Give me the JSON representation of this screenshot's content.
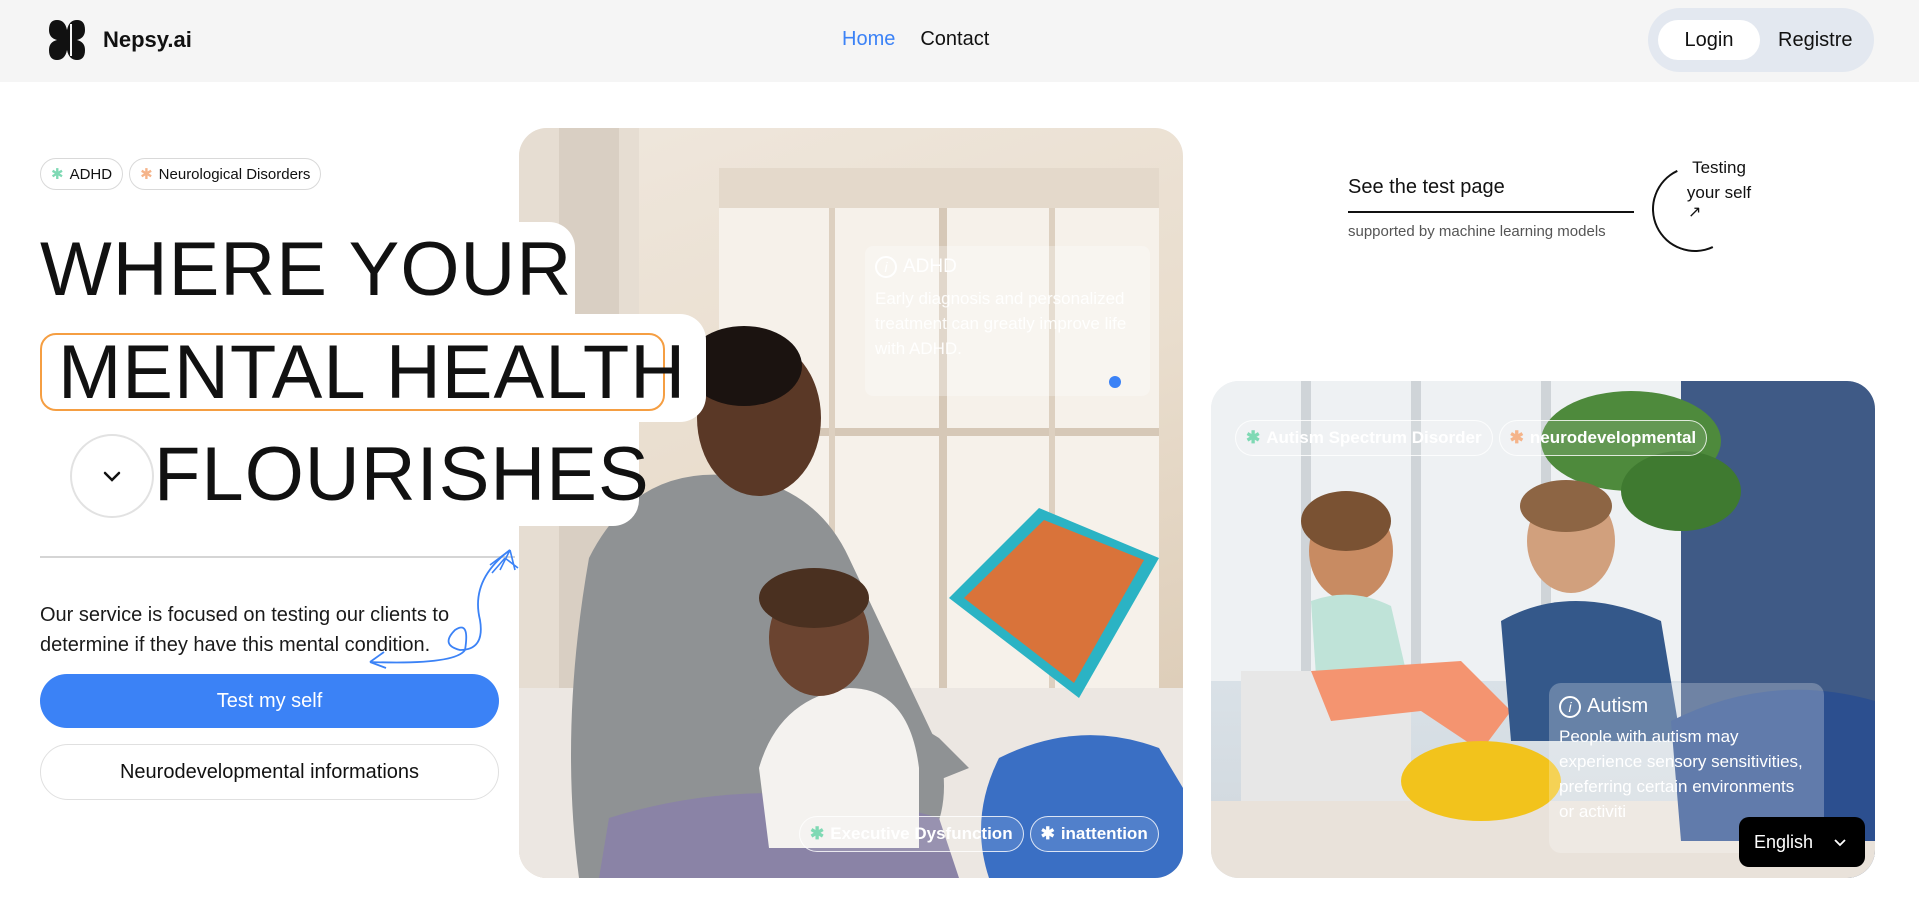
{
  "brand": {
    "name": "Nepsy.ai"
  },
  "nav": {
    "home": "Home",
    "contact": "Contact"
  },
  "auth": {
    "login": "Login",
    "register": "Registre"
  },
  "hero": {
    "tags": [
      "ADHD",
      "Neurological Disorders"
    ],
    "line1": "WHERE YOUR",
    "line2": "MENTAL HEALTH",
    "line3": "FLOURISHES",
    "description": "Our service is focused on testing our clients to determine if they have this mental condition.",
    "primary_button": "Test my self",
    "secondary_button": "Neurodevelopmental informations"
  },
  "adhd_card": {
    "title": "ADHD",
    "text": "Early diagnosis and personalized treatment can greatly improve life with ADHD.",
    "tags": [
      "Executive Dysfunction",
      "inattention"
    ]
  },
  "test_page": {
    "link": "See the test page",
    "sub": "supported by machine learning models",
    "circle_line1": "Testing",
    "circle_line2": "your self"
  },
  "autism_card": {
    "tags": [
      "Autism Spectrum Disorder",
      "neurodevelopmental"
    ],
    "title": "Autism",
    "text": "People with autism may experience sensory sensitivities, preferring certain environments or activiti"
  },
  "language": {
    "selected": "English"
  },
  "colors": {
    "accent": "#3b82f6",
    "highlight": "#f59e42",
    "tag_star_green": "#7fd9b4",
    "tag_star_peach": "#f5b48a"
  }
}
